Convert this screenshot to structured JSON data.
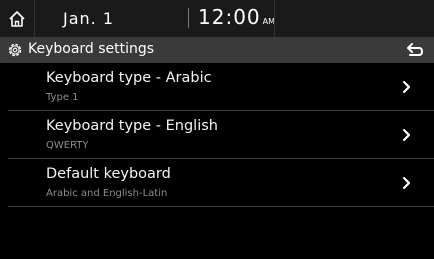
{
  "status": {
    "date": "Jan. 1",
    "time": "12:00",
    "ampm": "AM"
  },
  "header": {
    "title": "Keyboard settings"
  },
  "items": [
    {
      "title": "Keyboard type - Arabic",
      "subtitle": "Type 1"
    },
    {
      "title": "Keyboard type - English",
      "subtitle": "QWERTY"
    },
    {
      "title": "Default keyboard",
      "subtitle": "Arabic and English-Latin"
    }
  ],
  "icons": {
    "home": "home-icon",
    "settings": "gear-icon",
    "back": "back-arrow-icon",
    "chevron": "chevron-right-icon"
  },
  "colors": {
    "background": "#000000",
    "header": "#3a3a3a",
    "statusbar": "#1a1a1a",
    "subtitle": "#8e8e8e"
  }
}
